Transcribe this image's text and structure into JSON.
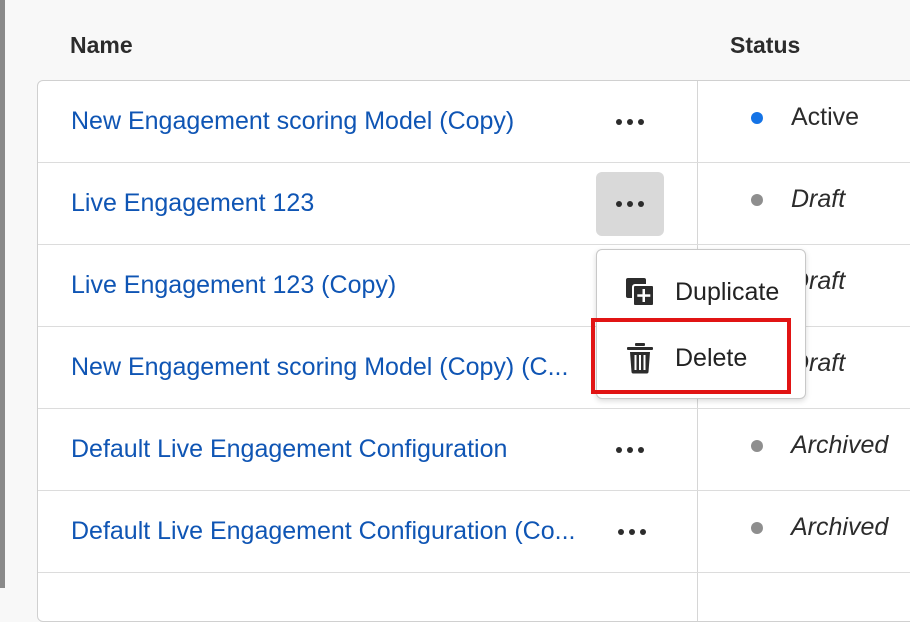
{
  "table": {
    "headers": {
      "name": "Name",
      "status": "Status"
    },
    "rows": [
      {
        "name": "New Engagement scoring Model (Copy)",
        "status": "Active",
        "status_color": "#1473e6",
        "italic": false
      },
      {
        "name": "Live Engagement 123",
        "status": "Draft",
        "status_color": "#8e8e8e",
        "italic": true
      },
      {
        "name": "Live Engagement 123 (Copy)",
        "status": "Draft",
        "status_color": "#8e8e8e",
        "italic": true
      },
      {
        "name": "New Engagement scoring Model (Copy) (C...",
        "status": "Draft",
        "status_color": "#8e8e8e",
        "italic": true
      },
      {
        "name": "Default Live Engagement Configuration",
        "status": "Archived",
        "status_color": "#8e8e8e",
        "italic": true
      },
      {
        "name": "Default Live Engagement Configuration (Co...",
        "status": "Archived",
        "status_color": "#8e8e8e",
        "italic": true
      }
    ]
  },
  "context_menu": {
    "items": [
      {
        "label": "Duplicate",
        "icon": "duplicate-icon"
      },
      {
        "label": "Delete",
        "icon": "trash-icon"
      }
    ],
    "highlighted": "Delete",
    "highlight_color": "#e11414"
  },
  "colors": {
    "link": "#0f55b4",
    "active_dot": "#1473e6",
    "inactive_dot": "#8e8e8e"
  }
}
